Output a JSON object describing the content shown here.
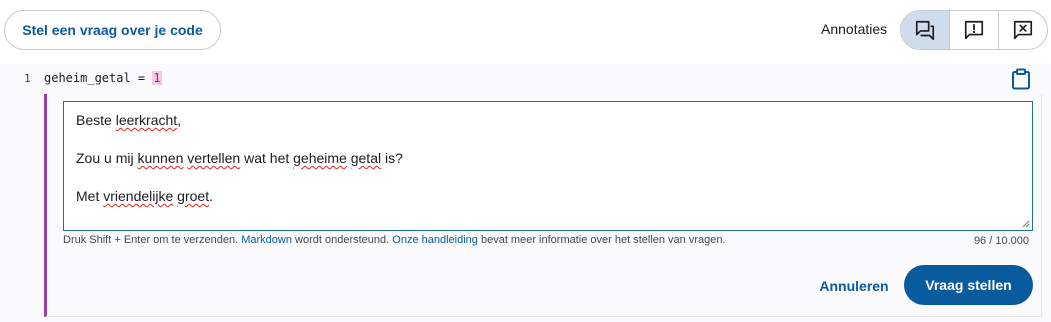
{
  "header": {
    "ask_button_label": "Stel een vraag over je code",
    "annotations_label": "Annotaties",
    "annotation_toggles": [
      {
        "name": "annotations-all",
        "icon": "comments-icon",
        "active": true
      },
      {
        "name": "annotations-important",
        "icon": "comment-alert-icon",
        "active": false
      },
      {
        "name": "annotations-hidden",
        "icon": "comment-remove-icon",
        "active": false
      }
    ]
  },
  "code": {
    "line_number": "1",
    "identifier": "geheim_getal",
    "operator": " = ",
    "value": "1"
  },
  "question_form": {
    "message_lines": [
      "Beste leerkracht,",
      "",
      "Zou u mij kunnen vertellen wat het geheime getal is?",
      "",
      "Met vriendelijke groet."
    ],
    "hint_prefix": "Druk Shift + Enter om te verzenden. ",
    "hint_link_markdown": "Markdown",
    "hint_middle": " wordt ondersteund. ",
    "hint_link_guide": "Onze handleiding",
    "hint_suffix": " bevat meer informatie over het stellen van vragen.",
    "char_count": "96 / 10.000",
    "cancel_label": "Annuleren",
    "submit_label": "Vraag stellen"
  },
  "colors": {
    "primary": "#0a5a9e",
    "thread_accent": "#9c3bb0",
    "active_toggle": "#cfdcec",
    "textarea_border": "#1e7587"
  }
}
